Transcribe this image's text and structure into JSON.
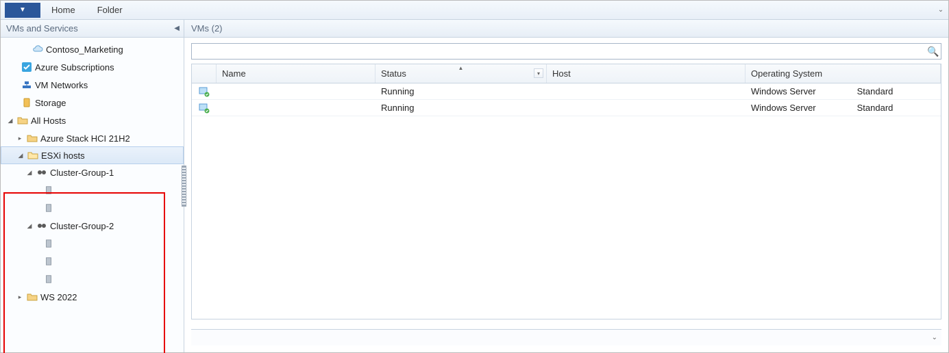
{
  "ribbon": {
    "tabs": [
      "Home",
      "Folder"
    ]
  },
  "sidebar": {
    "title": "VMs and Services",
    "tree": {
      "contoso_mkt": "Contoso_Marketing",
      "azure_sub": "Azure Subscriptions",
      "vm_networks": "VM Networks",
      "storage": "Storage",
      "all_hosts": "All Hosts",
      "azure_stack": "Azure Stack HCI 21H2",
      "esxi_hosts": "ESXi hosts",
      "cluster_groups": [
        "Cluster-Group-1",
        "Cluster-Group-2"
      ],
      "cluster1_hosts": [
        "",
        ""
      ],
      "cluster2_hosts": [
        "",
        "",
        ""
      ],
      "ws2022": "WS 2022"
    }
  },
  "main": {
    "header": "VMs (2)",
    "search_placeholder": "",
    "columns": {
      "name": "Name",
      "status": "Status",
      "host": "Host",
      "os": "Operating System"
    },
    "rows": [
      {
        "name": "",
        "status": "Running",
        "host": "",
        "os": "Windows Server",
        "edition": "Standard"
      },
      {
        "name": "",
        "status": "Running",
        "host": "",
        "os": "Windows Server",
        "edition": "Standard"
      }
    ]
  }
}
